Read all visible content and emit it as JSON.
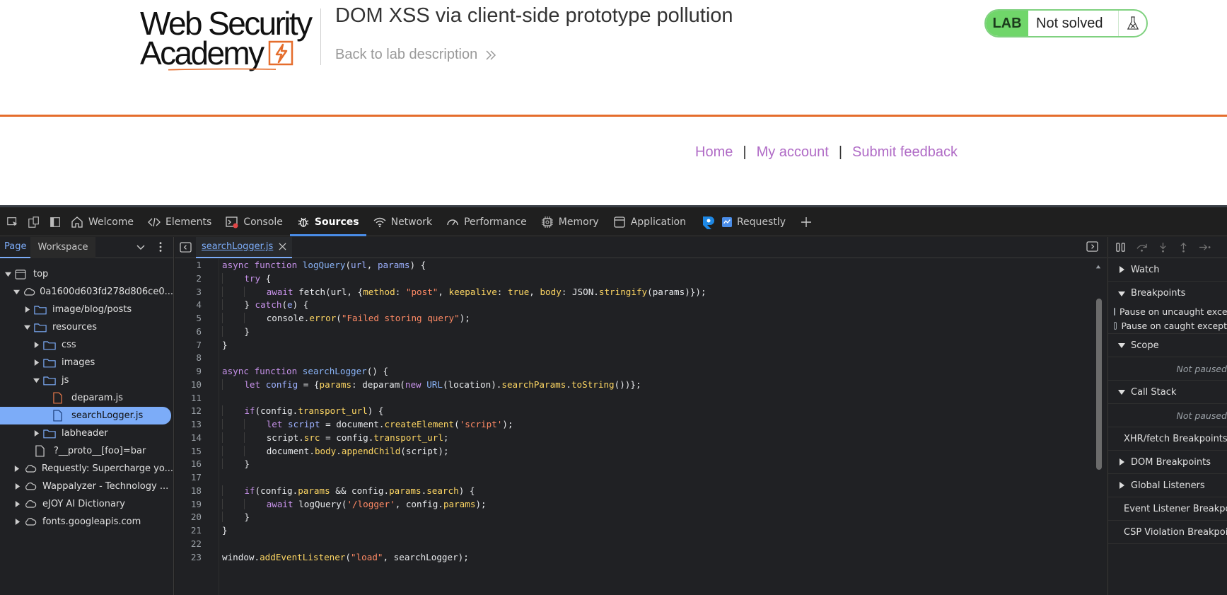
{
  "site": {
    "logo_line1": "Web Security",
    "logo_line2": "Academy",
    "lab_title": "DOM XSS via client-side prototype pollution",
    "back_link": "Back to lab description",
    "badge_label": "LAB",
    "badge_status": "Not solved",
    "nav": {
      "home": "Home",
      "sep": "|",
      "account": "My account",
      "feedback": "Submit feedback"
    },
    "colors": {
      "accent": "#e56d2c",
      "link": "#b06bc6",
      "badge_green": "#70d66a"
    }
  },
  "devtools": {
    "tabs": [
      {
        "label": "Welcome",
        "icon": "home-icon"
      },
      {
        "label": "Elements",
        "icon": "code-icon"
      },
      {
        "label": "Console",
        "icon": "console-icon"
      },
      {
        "label": "Sources",
        "icon": "bug-icon",
        "active": true
      },
      {
        "label": "Network",
        "icon": "wifi-icon"
      },
      {
        "label": "Performance",
        "icon": "gauge-icon"
      },
      {
        "label": "Memory",
        "icon": "chip-icon"
      },
      {
        "label": "Application",
        "icon": "window-icon"
      },
      {
        "label": "Requestly",
        "icon": "requestly-icon"
      }
    ],
    "navigator": {
      "tab_page": "Page",
      "tab_workspace": "Workspace",
      "tree": {
        "top": "top",
        "origin": "0a1600d603fd278d806ce0...",
        "image_blog_posts": "image/blog/posts",
        "resources": "resources",
        "css": "css",
        "images": "images",
        "js": "js",
        "deparam": "deparam.js",
        "searchLogger": "searchLogger.js",
        "labheader": "labheader",
        "proto_file": "?__proto__[foo]=bar",
        "requestly": "Requestly: Supercharge yo...",
        "wappalyzer": "Wappalyzer - Technology ...",
        "ejoy": "eJOY AI Dictionary",
        "fonts": "fonts.googleapis.com"
      }
    },
    "editor": {
      "file_tab": "searchLogger.js",
      "line_numbers": [
        "1",
        "2",
        "3",
        "4",
        "5",
        "6",
        "7",
        "8",
        "9",
        "10",
        "11",
        "12",
        "13",
        "14",
        "15",
        "16",
        "17",
        "18",
        "19",
        "20",
        "21",
        "22",
        "23"
      ]
    },
    "debugger": {
      "watch": "Watch",
      "breakpoints": "Breakpoints",
      "pause_uncaught": "Pause on uncaught exce",
      "pause_caught": "Pause on caught except",
      "scope": "Scope",
      "not_paused_1": "Not paused",
      "call_stack": "Call Stack",
      "not_paused_2": "Not paused",
      "xhr": "XHR/fetch Breakpoints",
      "dom": "DOM Breakpoints",
      "global": "Global Listeners",
      "event": "Event Listener Breakpoi",
      "csp": "CSP Violation Breakpoi"
    }
  }
}
